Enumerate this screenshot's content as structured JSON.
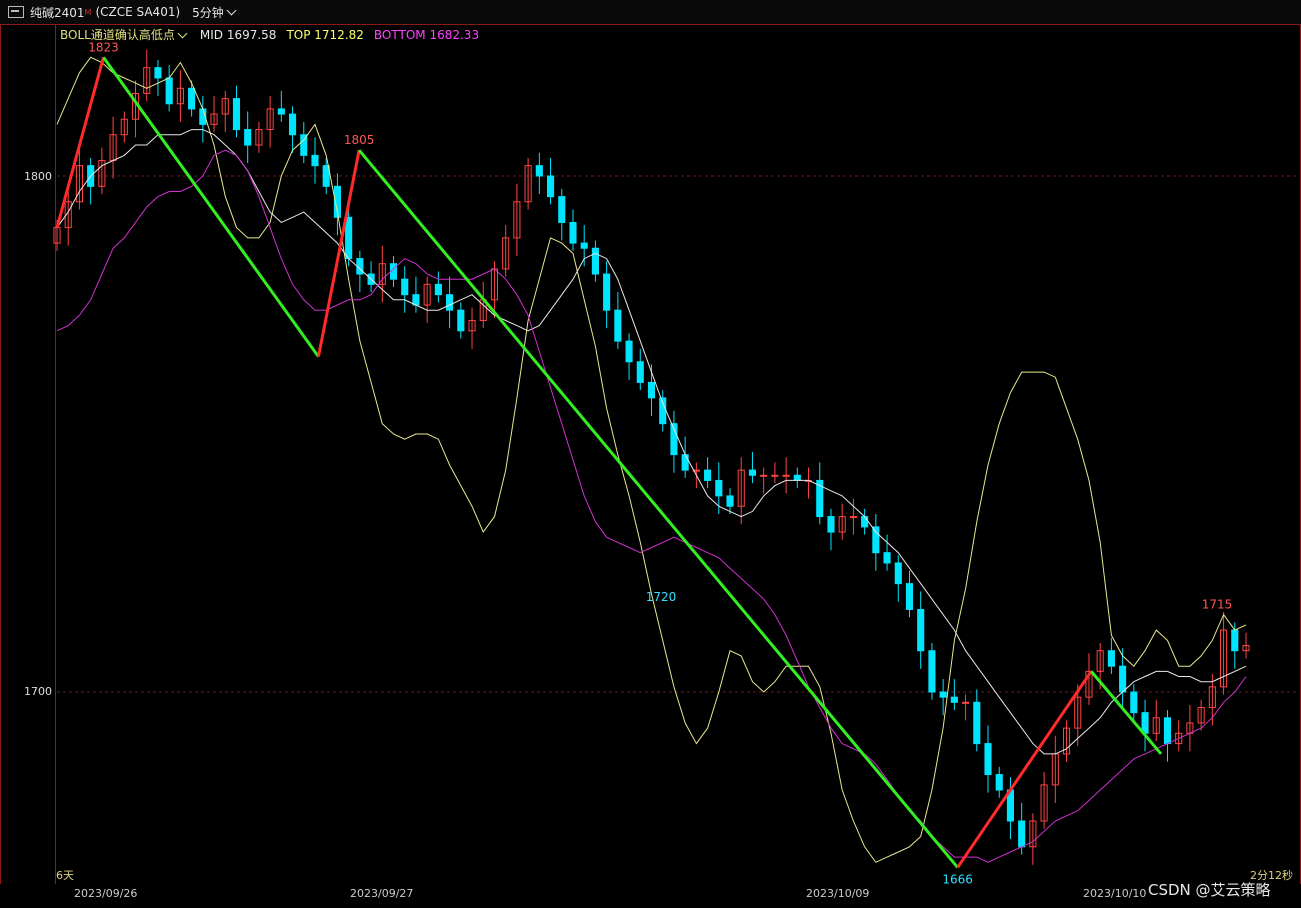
{
  "header": {
    "symbol": "纯碱2401",
    "mark": "M",
    "contract": "(CZCE SA401)",
    "period": "5分钟"
  },
  "indicator": {
    "name": "BOLL通道确认高低点",
    "mid_label": "MID",
    "mid_value": "1697.58",
    "top_label": "TOP",
    "top_value": "1712.82",
    "bottom_label": "BOTTOM",
    "bottom_value": "1682.33"
  },
  "corner": {
    "left": "6天",
    "right": "2分12秒"
  },
  "watermark": "CSDN @艾云策略",
  "chart_data": {
    "type": "line",
    "description_series": "candlestick price with Bollinger bands and zigzag swing lines",
    "x": [
      "2023/09/26",
      "2023/09/27",
      "2023/10/09",
      "2023/10/10"
    ],
    "yticks": [
      1700,
      1800
    ],
    "ylim": [
      1663,
      1826
    ],
    "colors": {
      "up": "#ff4444",
      "down": "#00e5ff",
      "top": "#e8e890",
      "mid": "#e8e8e8",
      "bottom": "#d030d0",
      "zig_up": "#ff2a2a",
      "zig_down": "#33ee22"
    },
    "close": [
      1790,
      1795,
      1802,
      1798,
      1803,
      1808,
      1811,
      1816,
      1821,
      1819,
      1814,
      1817,
      1813,
      1810,
      1812,
      1815,
      1809,
      1806,
      1809,
      1813,
      1812,
      1808,
      1804,
      1802,
      1798,
      1792,
      1784,
      1781,
      1779,
      1783,
      1780,
      1777,
      1775,
      1779,
      1777,
      1774,
      1770,
      1772,
      1776,
      1782,
      1788,
      1795,
      1802,
      1800,
      1796,
      1791,
      1787,
      1786,
      1781,
      1774,
      1768,
      1764,
      1760,
      1757,
      1752,
      1746,
      1743,
      1743,
      1741,
      1738,
      1736,
      1743,
      1742,
      1742,
      1742,
      1742,
      1741,
      1741,
      1734,
      1731,
      1734,
      1734,
      1732,
      1727,
      1725,
      1721,
      1716,
      1708,
      1700,
      1699,
      1698,
      1698,
      1690,
      1684,
      1681,
      1675,
      1670,
      1675,
      1682,
      1688,
      1693,
      1699,
      1704,
      1708,
      1705,
      1700,
      1696,
      1692,
      1695,
      1690,
      1692,
      1694,
      1697,
      1701,
      1712,
      1708,
      1709
    ],
    "top": [
      1810,
      1815,
      1820,
      1823,
      1822,
      1820,
      1819,
      1818,
      1817,
      1818,
      1819,
      1822,
      1818,
      1813,
      1806,
      1796,
      1790,
      1788,
      1788,
      1791,
      1800,
      1805,
      1807,
      1810,
      1804,
      1793,
      1780,
      1768,
      1760,
      1752,
      1750,
      1749,
      1750,
      1750,
      1749,
      1744,
      1740,
      1736,
      1731,
      1734,
      1743,
      1757,
      1772,
      1780,
      1788,
      1787,
      1785,
      1776,
      1767,
      1755,
      1746,
      1738,
      1729,
      1719,
      1710,
      1701,
      1694,
      1690,
      1693,
      1700,
      1708,
      1707,
      1702,
      1700,
      1702,
      1705,
      1705,
      1705,
      1701,
      1692,
      1681,
      1675,
      1670,
      1667,
      1668,
      1669,
      1670,
      1672,
      1681,
      1693,
      1710,
      1720,
      1733,
      1744,
      1752,
      1758,
      1762,
      1762,
      1762,
      1761,
      1755,
      1749,
      1741,
      1729,
      1711,
      1707,
      1705,
      1708,
      1712,
      1710,
      1705,
      1705,
      1707,
      1710,
      1715,
      1712,
      1713
    ],
    "mid": [
      1790,
      1793,
      1797,
      1800,
      1802,
      1803,
      1804,
      1806,
      1806,
      1808,
      1808,
      1808,
      1809,
      1809,
      1808,
      1806,
      1804,
      1801,
      1797,
      1793,
      1791,
      1792,
      1793,
      1791,
      1789,
      1787,
      1784,
      1782,
      1780,
      1778,
      1776,
      1776,
      1775,
      1774,
      1774,
      1775,
      1776,
      1777,
      1775,
      1773,
      1772,
      1771,
      1770,
      1771,
      1774,
      1777,
      1780,
      1784,
      1785,
      1784,
      1780,
      1774,
      1768,
      1762,
      1756,
      1751,
      1746,
      1742,
      1738,
      1736,
      1735,
      1734,
      1735,
      1738,
      1740,
      1741,
      1741,
      1741,
      1740,
      1739,
      1738,
      1736,
      1734,
      1731,
      1729,
      1727,
      1724,
      1721,
      1718,
      1715,
      1712,
      1708,
      1705,
      1702,
      1699,
      1696,
      1693,
      1690,
      1688,
      1688,
      1689,
      1691,
      1693,
      1695,
      1698,
      1700,
      1702,
      1703,
      1704,
      1704,
      1703,
      1703,
      1702,
      1702,
      1703,
      1704,
      1705
    ],
    "bottom": [
      1770,
      1771,
      1773,
      1776,
      1781,
      1786,
      1788,
      1791,
      1794,
      1796,
      1797,
      1797,
      1798,
      1800,
      1804,
      1805,
      1804,
      1801,
      1796,
      1790,
      1784,
      1779,
      1776,
      1774,
      1774,
      1775,
      1776,
      1776,
      1777,
      1780,
      1782,
      1784,
      1783,
      1781,
      1780,
      1780,
      1780,
      1780,
      1781,
      1782,
      1780,
      1777,
      1773,
      1766,
      1759,
      1752,
      1745,
      1738,
      1733,
      1730,
      1729,
      1728,
      1727,
      1728,
      1729,
      1730,
      1729,
      1728,
      1727,
      1726,
      1724,
      1722,
      1720,
      1718,
      1715,
      1711,
      1706,
      1701,
      1697,
      1693,
      1690,
      1689,
      1688,
      1686,
      1683,
      1680,
      1677,
      1675,
      1672,
      1670,
      1668,
      1668,
      1668,
      1667,
      1668,
      1669,
      1670,
      1671,
      1673,
      1675,
      1676,
      1677,
      1679,
      1681,
      1683,
      1685,
      1687,
      1688,
      1689,
      1690,
      1691,
      1692,
      1693,
      1695,
      1698,
      1700,
      1703
    ],
    "swings": [
      {
        "value": 1790,
        "index": 0
      },
      {
        "value": 1823,
        "index": 8,
        "label": "1823"
      },
      {
        "value": 1765,
        "index": 45
      },
      {
        "value": 1805,
        "index": 52,
        "label": "1805"
      },
      {
        "value": 1666,
        "index": 155,
        "label": "1666"
      },
      {
        "value": 1704,
        "index": 178
      },
      {
        "value": 1688,
        "index": 190
      }
    ],
    "annotations": [
      {
        "text": "1720",
        "value": 1720
      },
      {
        "text": "1715",
        "value": 1715
      }
    ]
  }
}
